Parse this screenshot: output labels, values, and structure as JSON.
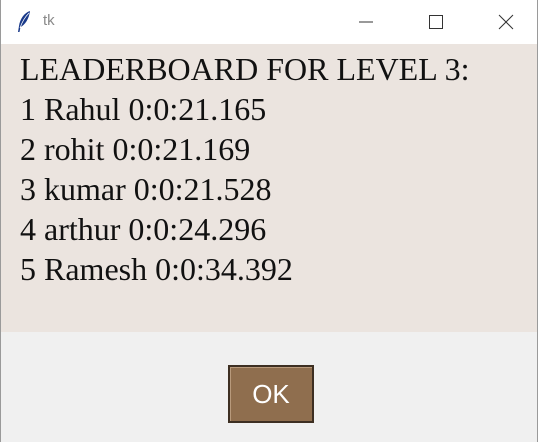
{
  "window": {
    "title": "tk",
    "icon": "feather-icon",
    "controls": [
      "minimize-icon",
      "maximize-icon",
      "close-icon"
    ]
  },
  "leaderboard": {
    "heading": "LEADERBOARD FOR LEVEL 3:",
    "rows": [
      "1 Rahul 0:0:21.165",
      "2 rohit 0:0:21.169",
      "3 kumar 0:0:21.528",
      "4 arthur 0:0:24.296",
      "5 Ramesh 0:0:34.392"
    ]
  },
  "actions": {
    "ok_label": "OK"
  },
  "colors": {
    "content_bg": "#ebe4df",
    "button_bg": "#8f6e4e",
    "window_bg": "#f0f0f0"
  }
}
